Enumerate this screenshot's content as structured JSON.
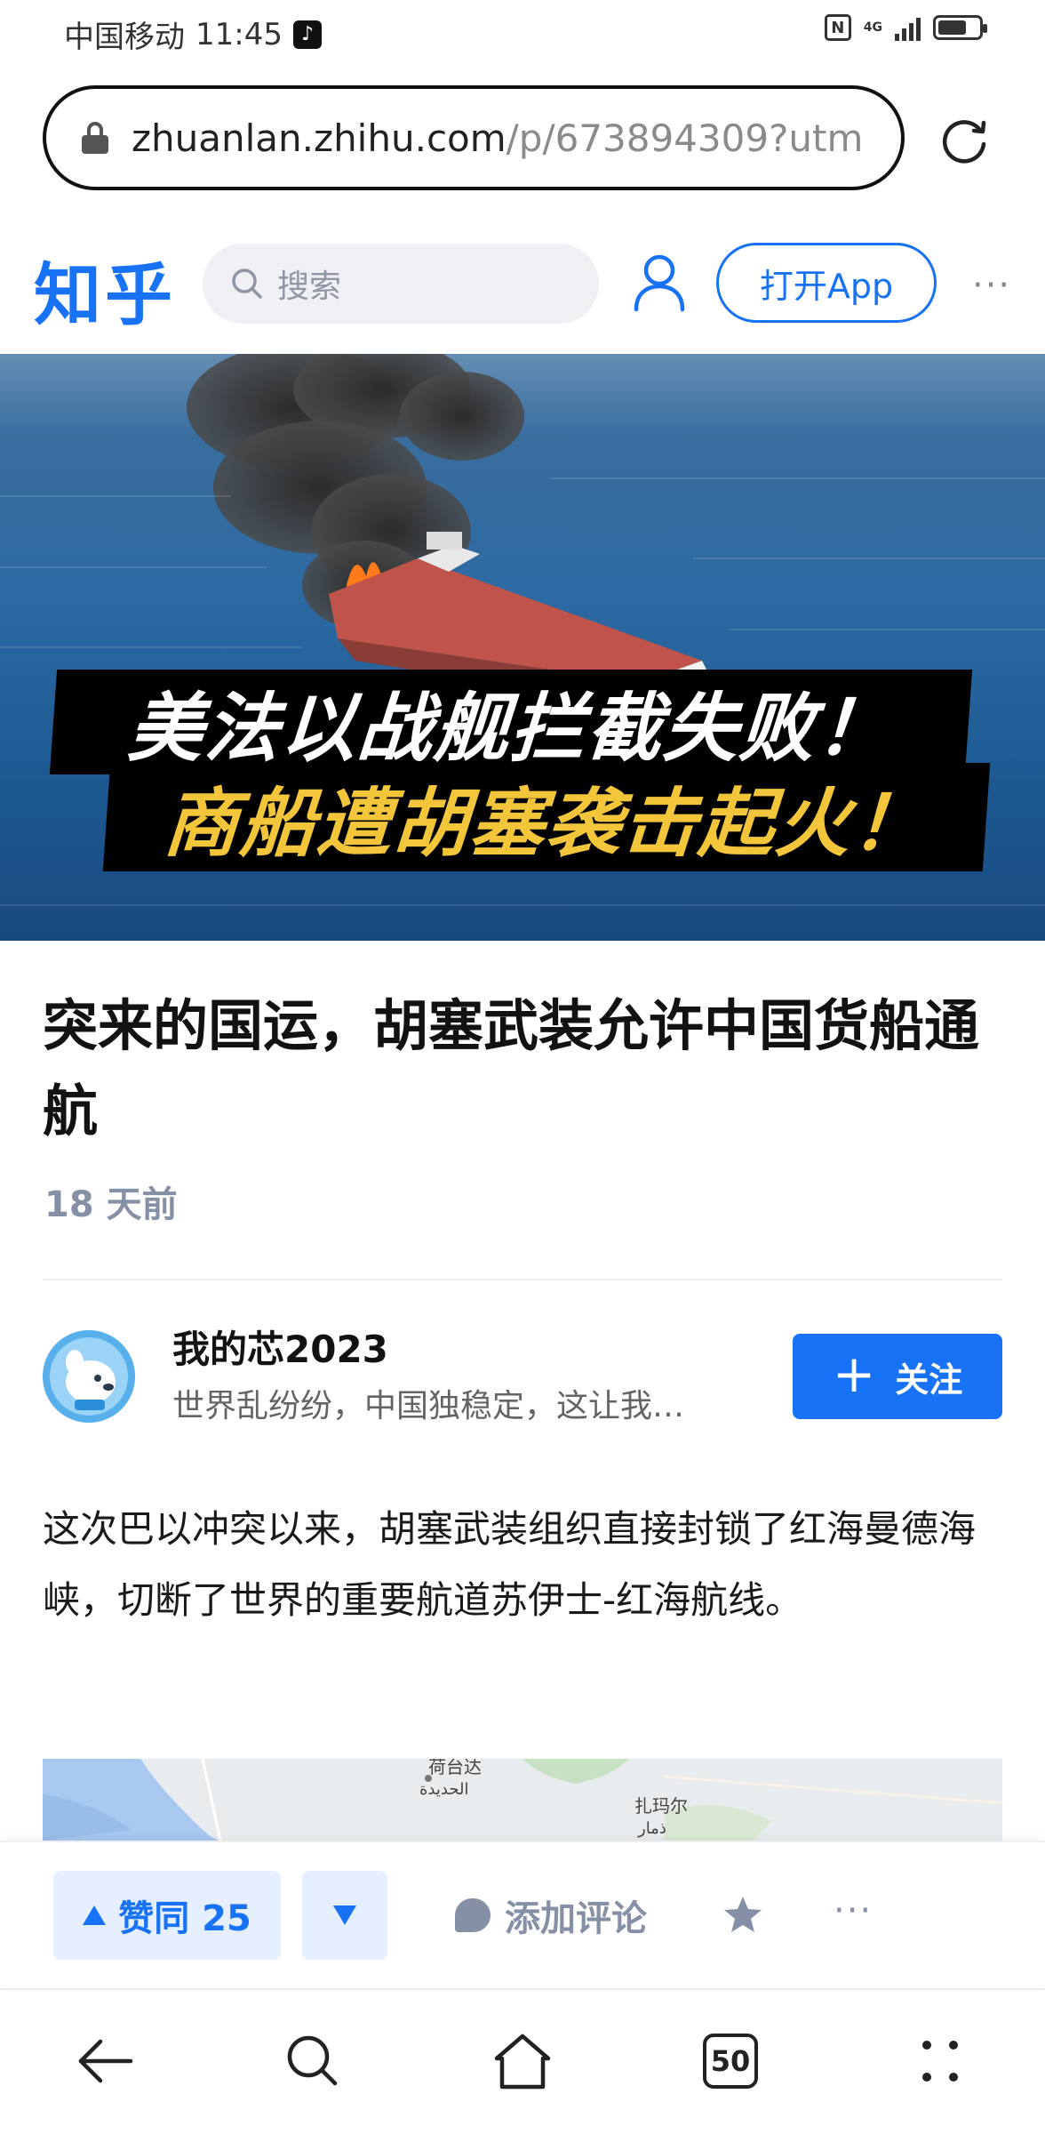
{
  "status_bar": {
    "carrier": "中国移动",
    "time": "11:45",
    "network": "4G",
    "battery_level": 0.7
  },
  "browser": {
    "url_host": "zhuanlan.zhihu.com",
    "url_path": "/p/673894309?utm",
    "tabs_count": "50"
  },
  "header": {
    "logo": "知乎",
    "search_placeholder": "搜索",
    "open_app_label": "打开App",
    "more": "···"
  },
  "hero": {
    "line1": "美法以战舰拦截失败！",
    "line2": "商船遭胡塞袭击起火！"
  },
  "article": {
    "title": "突来的国运，胡塞武装允许中国货船通航",
    "time": "18 天前",
    "body": "这次巴以冲突以来，胡塞武装组织直接封锁了红海曼德海峡，切断了世界的重要航道苏伊士-红海航线。"
  },
  "map": {
    "labels": [
      "荷台达",
      "الحديدة",
      "扎玛尔",
      "ذمار"
    ]
  },
  "author": {
    "name": "我的芯2023",
    "bio": "世界乱纷纷，中国独稳定，这让我…",
    "follow_label": "关注"
  },
  "actions": {
    "vote_up_label": "赞同 25",
    "comment_label": "添加评论",
    "more": "···"
  },
  "colors": {
    "brand": "#1772f6",
    "vote_bg": "#e5efff",
    "muted": "#8590a6",
    "hero_highlight": "#f3c53b"
  }
}
